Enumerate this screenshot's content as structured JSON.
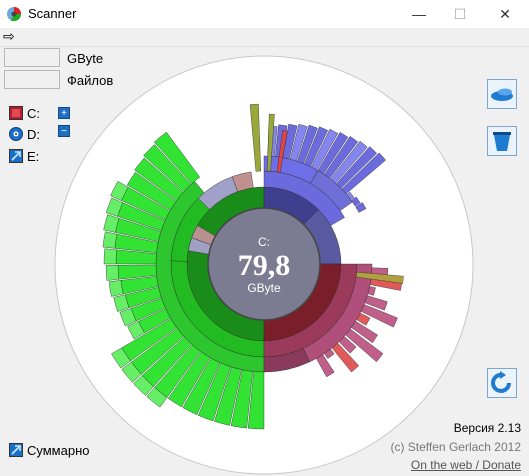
{
  "window": {
    "title": "Scanner",
    "minimize": "—",
    "maximize": "☐",
    "close": "✕"
  },
  "menu": {
    "arrow": "⇨"
  },
  "fields": {
    "gbyte_label": "GByte",
    "files_label": "Файлов"
  },
  "drives": [
    {
      "label": "C:",
      "color": "#c0202a"
    },
    {
      "label": "D:",
      "color": "#1a6fc7"
    },
    {
      "label": "E:",
      "color": "#1a6fc7"
    }
  ],
  "tiny_buttons": {
    "plus": "+",
    "minus": "−"
  },
  "center": {
    "drive": "C:",
    "value": "79,8",
    "unit": "GByte"
  },
  "summary_label": "Суммарно",
  "version": "Версия 2.13",
  "copyright": "(c) Steffen Gerlach 2012",
  "link": "On the web / Donate",
  "colors": {
    "green": "#22dd22",
    "darkgreen": "#1a8c1a",
    "blue": "#6b6bdd",
    "maroon": "#7a1f2a",
    "pink": "#b0507a",
    "hub": "#7a7a90"
  },
  "icons": [
    "app-icon",
    "arrow-icon",
    "drive-c-icon",
    "disc-icon",
    "drive-e-icon",
    "zoom-icon",
    "trash-icon",
    "refresh-icon",
    "summary-icon"
  ]
}
